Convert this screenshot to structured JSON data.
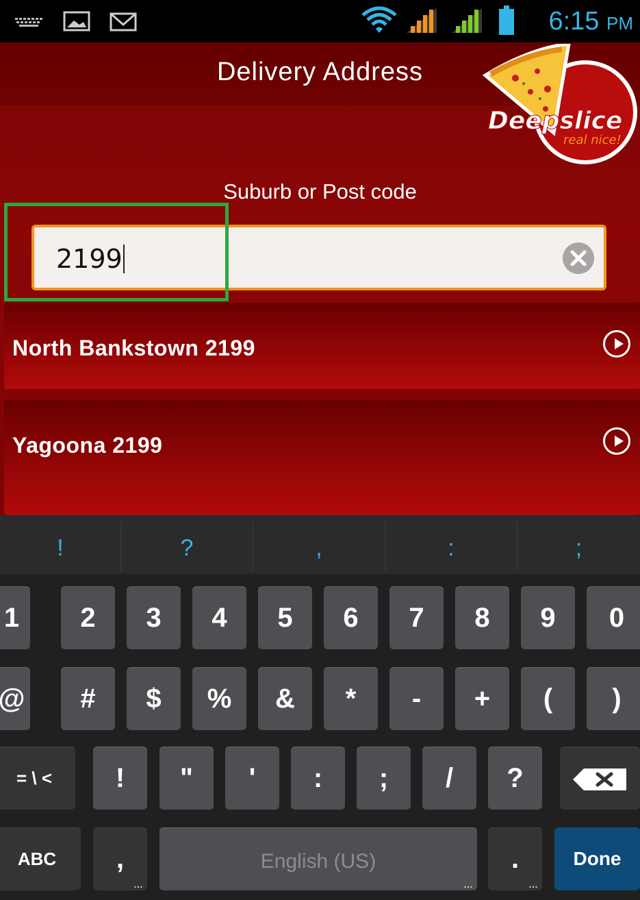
{
  "status_bar": {
    "time": "6:15",
    "ampm": "PM",
    "icons": [
      "keyboard-icon",
      "image-icon",
      "gmail-icon",
      "wifi-icon",
      "signal-icon",
      "signal-icon-2",
      "battery-icon"
    ]
  },
  "header": {
    "title": "Delivery Address",
    "logo": {
      "name": "Deepslice",
      "tagline": "real nice!"
    }
  },
  "form": {
    "label": "Suburb or Post code",
    "input_value": "2199"
  },
  "results": [
    {
      "label": "North Bankstown 2199"
    },
    {
      "label": "Yagoona 2199"
    }
  ],
  "keyboard": {
    "suggestions": [
      "!",
      "?",
      ",",
      ":",
      ";"
    ],
    "row1": [
      "1",
      "2",
      "3",
      "4",
      "5",
      "6",
      "7",
      "8",
      "9",
      "0"
    ],
    "row2": [
      "@",
      "#",
      "$",
      "%",
      "&",
      "*",
      "-",
      "+",
      "(",
      ")"
    ],
    "row3": [
      "= \\ <",
      "!",
      "\"",
      "'",
      ":",
      ";",
      "/",
      "?"
    ],
    "abc": "ABC",
    "comma": ",",
    "space": "English (US)",
    "period": ".",
    "done": "Done"
  }
}
